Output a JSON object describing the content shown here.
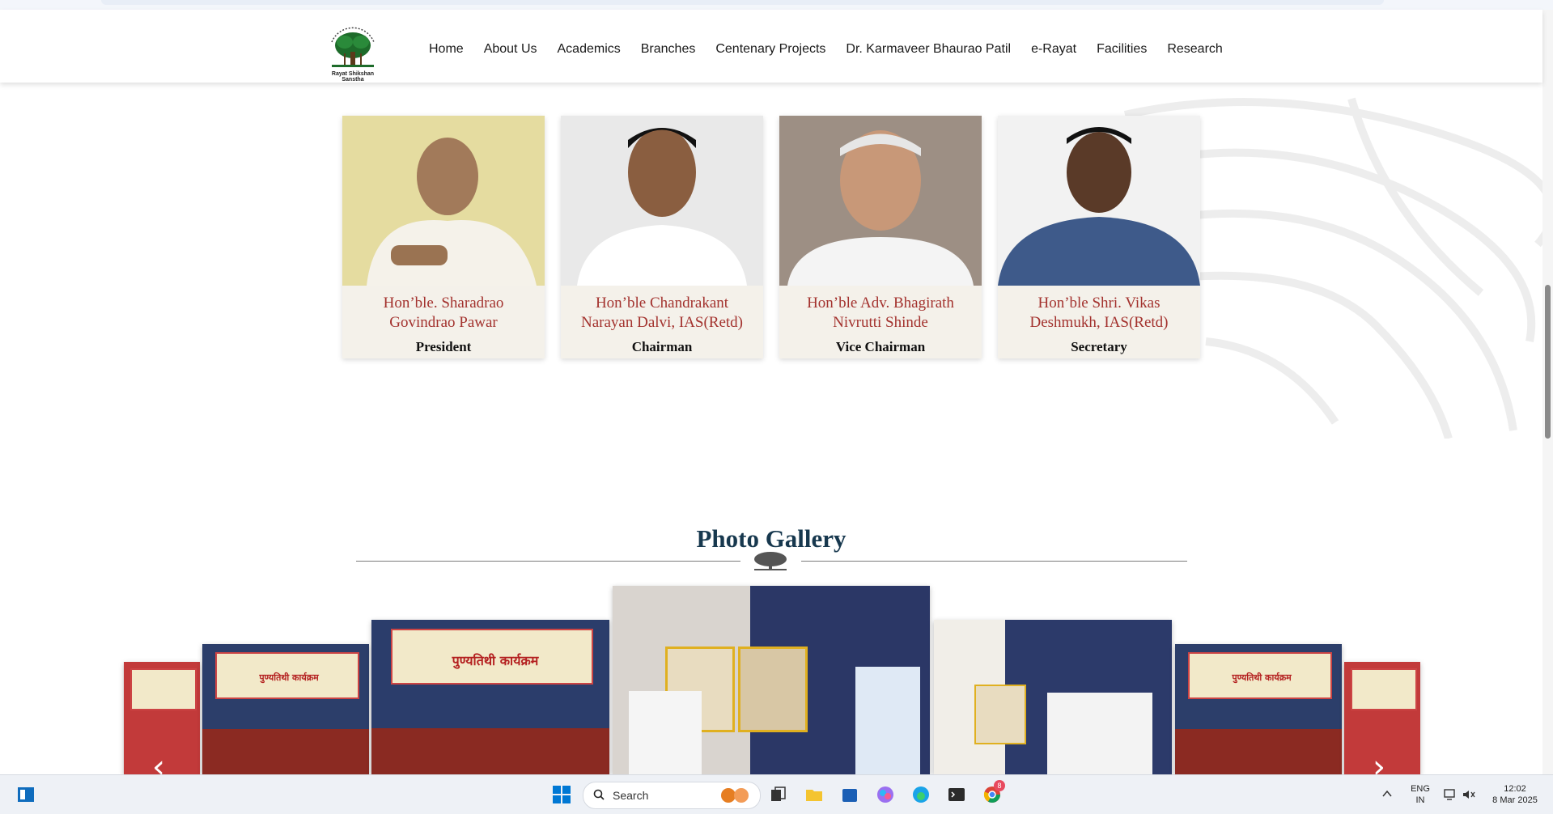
{
  "header": {
    "logo_caption": "Rayat Shikshan Sanstha",
    "nav": [
      "Home",
      "About Us",
      "Academics",
      "Branches",
      "Centenary Projects",
      "Dr. Karmaveer Bhaurao Patil",
      "e-Rayat",
      "Facilities",
      "Research"
    ]
  },
  "leaders": [
    {
      "name": "Hon’ble. Sharadrao Govindrao Pawar",
      "role": "President"
    },
    {
      "name": "Hon’ble Chandrakant Narayan Dalvi, IAS(Retd)",
      "role": "Chairman"
    },
    {
      "name": "Hon’ble Adv. Bhagirath Nivrutti Shinde",
      "role": "Vice Chairman"
    },
    {
      "name": "Hon’ble Shri. Vikas Deshmukh, IAS(Retd)",
      "role": "Secretary"
    }
  ],
  "gallery": {
    "title": "Photo Gallery",
    "banner_text": "पुण्यतिथी कार्यक्रम",
    "prev_arrow": "‹",
    "next_arrow": "›"
  },
  "taskbar": {
    "search_label": "Search",
    "lang_top": "ENG",
    "lang_bottom": "IN",
    "time": "12:02",
    "date": "8 Mar 2025",
    "chrome_badge": "8"
  }
}
